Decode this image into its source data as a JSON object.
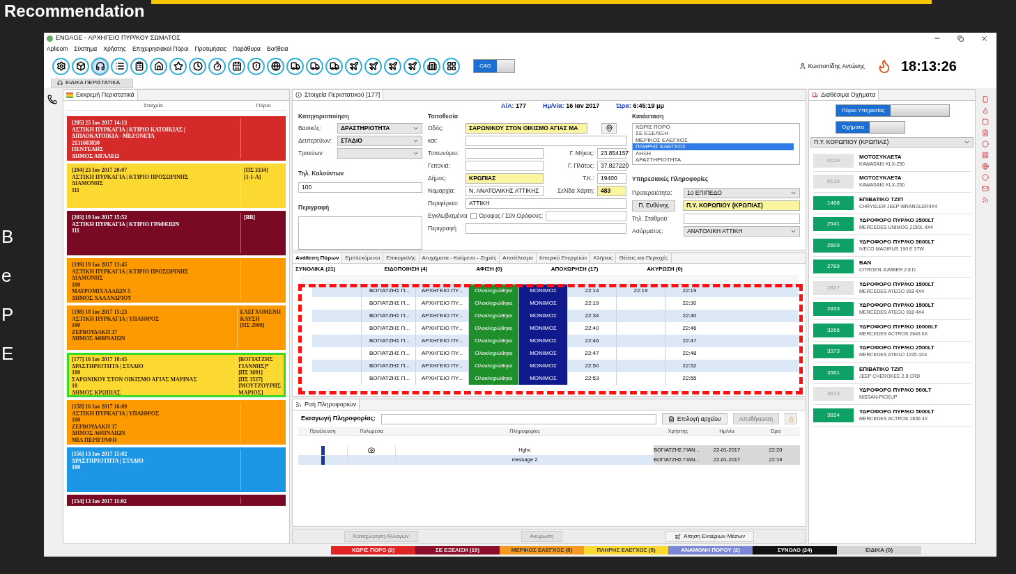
{
  "slide": {
    "title": "Recommendation",
    "side_letters": [
      "B",
      "e",
      "P",
      "E"
    ]
  },
  "window": {
    "title": "ENGAGE - ΑΡΧΗΓΕΙΟ ΠΥΡ/ΚΟΥ ΣΩΜΑΤΟΣ"
  },
  "menu": [
    "Aplicom",
    "Σύστημα",
    "Χρήστης",
    "Επιχειρησιακοί Πόροι",
    "Προτιμήσεις",
    "Παράθυρα",
    "Βοήθεια"
  ],
  "toolbar": {
    "buttons": [
      {
        "kind": "gear",
        "selected": false
      },
      {
        "kind": "box",
        "selected": false
      },
      {
        "kind": "headset",
        "selected": true
      },
      {
        "kind": "list",
        "selected": false
      },
      {
        "kind": "clipboard",
        "selected": false
      },
      {
        "kind": "house",
        "selected": false
      },
      {
        "kind": "star",
        "selected": false
      },
      {
        "kind": "clock",
        "selected": false
      },
      {
        "kind": "timer",
        "selected": false
      },
      {
        "kind": "calendar",
        "selected": false
      },
      {
        "kind": "shield",
        "selected": false
      },
      {
        "kind": "globe",
        "selected": false
      },
      {
        "kind": "truck",
        "selected": false
      },
      {
        "kind": "truck",
        "selected": false
      },
      {
        "kind": "truck",
        "selected": false
      },
      {
        "kind": "plane",
        "selected": false
      },
      {
        "kind": "plane",
        "selected": false
      },
      {
        "kind": "plane",
        "selected": false
      },
      {
        "kind": "plane",
        "selected": false
      },
      {
        "kind": "building",
        "selected": false
      },
      {
        "kind": "grid",
        "selected": false
      }
    ],
    "cad": {
      "label": "CAD",
      "on": true
    },
    "special_button": "ΕΙΔΙΚΑ ΠΕΡΙΣΤΑΤΙΚΑ",
    "user": "Κωστοπίδης Αντώνης",
    "clock": "18:13:26"
  },
  "pending": {
    "title": "Εκκρεμή Περιστατικά",
    "columns": [
      "Στοιχεία",
      "Πόροι"
    ],
    "incidents": [
      {
        "lines": [
          "[205] 25 Ιαν 2017 14:13",
          "ΑΣΤΙΚΗ ΠΥΡΚΑΓΙΑ | ΚΤΙΡΙΟ ΚΑΤΟΙΚΙΑΣ |",
          "ΔΙΠΛΟΚΑΤΟΙΚΙΑ - ΜΕΖΟΝΕΤΑ",
          "2131603830",
          "ΠΕΝΤΕΛΗΣ",
          "ΔΗΜΟΣ ΑΙΓΑΛΕΩ"
        ],
        "color": "#d42a2a",
        "selected": false
      },
      {
        "lines": [
          "[204] 23 Ιαν 2017 20:07",
          "ΑΣΤΙΚΗ ΠΥΡΚΑΓΙΑ | ΚΤΙΡΙΟ ΠΡΟΣΩΡΙΝΗΣ",
          "ΔΙΑΜΟΝΗΣ",
          "111"
        ],
        "resources": [
          "[ΠΣ 3334]",
          "[1-1-Α]"
        ],
        "color": "#fbd930",
        "selected": false
      },
      {
        "lines": [
          "[203] 19 Ιαν 2017 15:52",
          "ΑΣΤΙΚΗ ΠΥΡΚΑΓΙΑ | ΚΤΙΡΙΟ ΓΡΑΦΕΙΩΝ",
          "111"
        ],
        "resources": [
          "[ΒΒ]"
        ],
        "color": "#7a0a24",
        "selected": false
      },
      {
        "lines": [
          "[199] 19 Ιαν 2017 13:45",
          "ΑΣΤΙΚΗ ΠΥΡΚΑΓΙΑ | ΚΤΙΡΙΟ ΠΡΟΣΩΡΙΝΗΣ",
          "ΔΙΑΜΟΝΗΣ",
          "100",
          "ΜΑΥΡΟΜΙΧΑΛΑΙΩΝ 5",
          "ΔΗΜΟΣ ΧΑΛΑΝΔΡΙΟΥ"
        ],
        "color": "#fd9a00",
        "selected": false
      },
      {
        "lines": [
          "[198] 18 Ιαν 2017 15:23",
          "ΑΣΤΙΚΗ ΠΥΡΚΑΓΙΑ | ΥΠΑΙΘΡΟΣ",
          "100",
          "ΖΕΡΒΟΥΔΑΚΗ 37",
          "ΔΗΜΟΣ ΑΘΗΝΑΙΩΝ"
        ],
        "resources": [
          "ΕΛΕΓΧΟΜΕΝΗ",
          "ΚΑΥΣΗ",
          "[ΠΣ 2908]"
        ],
        "color": "#fd9a00",
        "selected": false
      },
      {
        "lines": [
          "[177] 16 Ιαν 2017 18:45",
          "ΔΡΑΣΤΗΡΙΟΤΗΤΑ | ΣΤΑΔΙΟ",
          "100",
          "ΣΑΡΩΝΙΚΟΥ ΣΤΟΝ ΟΙΚΙΣΜΟ ΑΓΙΑΣ ΜΑΡΙΝΑΣ",
          "10",
          "ΔΗΜΟΣ ΚΡΩΠΙΑΣ"
        ],
        "resources": [
          "[ΒΟΓΙΑΤΖΗΣ",
          "ΓΙΑΝΝΗΣ]*",
          "[ΠΣ 3691]",
          "[ΠΣ 3527]",
          "[ΜΟΥΤΖΟΥΡΗΣ",
          "ΜΑΡΙΟΣ]"
        ],
        "color": "#fbd930",
        "selected": true
      },
      {
        "lines": [
          "[158] 16 Ιαν 2017 16:09",
          "ΑΣΤΙΚΗ ΠΥΡΚΑΓΙΑ | ΥΠΑΙΘΡΟΣ",
          "100",
          "ΖΕΡΒΟΥΔΑΚΗ 37",
          "ΔΗΜΟΣ ΑΘΗΝΑΙΩΝ",
          "ΜΙΑ ΠΕΡΙΓΡΑΦΗ"
        ],
        "color": "#fd9a00",
        "selected": false
      },
      {
        "lines": [
          "[156] 13 Ιαν 2017 15:02",
          "ΔΡΑΣΤΗΡΙΟΤΗΤΑ | ΣΤΑΔΙΟ",
          "100"
        ],
        "color": "#1e96e6",
        "selected": false
      },
      {
        "lines": [
          "[154] 13 Ιαν 2017 11:02"
        ],
        "color": "#7a0a24",
        "selected": false
      }
    ]
  },
  "details": {
    "title": "Στοιχεία Περιστατικού [177]",
    "header": [
      {
        "label": "Α/Α:",
        "value": "177"
      },
      {
        "label": "Ημ/νία:",
        "value": "16 Ιαν 2017"
      },
      {
        "label": "Ώρα:",
        "value": "6:45:19 μμ"
      }
    ],
    "classification": {
      "title": "Κατηγοριοποίηση",
      "fields": [
        {
          "label": "Βασικός:",
          "value": "ΔΡΑΣΤΗΡΙΟΤΗΤΑ"
        },
        {
          "label": "Δευτερεύων:",
          "value": "ΣΤΑΔΙΟ"
        },
        {
          "label": "Τριτεύων:"
        }
      ]
    },
    "caller": {
      "label": "Τηλ. Καλούντων",
      "value": "100"
    },
    "description": {
      "label": "Περιγραφή"
    },
    "location": {
      "title": "Τοποθεσία",
      "rows": [
        [
          {
            "label": "Οδός:",
            "value": "ΣΑΡΩΝΙΚΟΥ ΣΤΟΝ ΟΙΚΙΣΜΟ ΑΓΙΑΣ ΜΑ",
            "highlighted": true
          }
        ],
        [
          {
            "label": "και:",
            "highlighted": false
          }
        ],
        [
          {
            "label": "Τοπωνύμιο:",
            "highlighted": false
          },
          {
            "label": "Γ. Μήκος:",
            "value": "23.854157",
            "highlighted": false
          }
        ],
        [
          {
            "label": "Γειτονιά:",
            "highlighted": false
          },
          {
            "label": "Γ. Πλάτος:",
            "value": "37.827220",
            "highlighted": false
          }
        ],
        [
          {
            "label": "Δήμος:",
            "value": "ΚΡΩΠΙΑΣ",
            "highlighted": true
          },
          {
            "label": "Τ.Κ.:",
            "value": "19400",
            "highlighted": false
          }
        ],
        [
          {
            "label": "Νομαρχία:",
            "value": "Ν. ΑΝΑΤΟΛΙΚΗΣ ΑΤΤΙΚΗΣ",
            "highlighted": false
          },
          {
            "label": "Σελίδα Χάρτη:",
            "value": "483",
            "highlighted": true
          }
        ],
        [
          {
            "label": "Περιφέρεια:",
            "value": "ΑΤΤΙΚΗ",
            "highlighted": false
          }
        ]
      ],
      "trapped": {
        "label": "Εγκλωβισμένοι",
        "checked": false
      },
      "floor_label": "Όροφος / Σύν.Ορόφους:",
      "description_label": "Περιγραφή"
    },
    "status": {
      "title": "Κατάσταση",
      "items": [
        {
          "label": "ΧΩΡΙΣ ΠΟΡΟ",
          "selected": false
        },
        {
          "label": "ΣΕ ΕΞΕΛΙΞΗ",
          "selected": false
        },
        {
          "label": "ΜΕΡΙΚΟΣ ΕΛΕΓΧΟΣ",
          "selected": false
        },
        {
          "label": "ΠΛΗΡΗΣ ΕΛΕΓΧΟΣ",
          "selected": true
        },
        {
          "label": "ΛΗΞΗ",
          "selected": false
        },
        {
          "label": "ΔΡΑΣΤΗΡΙΟΤΗΤΑ",
          "selected": false
        }
      ]
    },
    "service": {
      "title": "Υπηρεσιακές Πληροφορίες",
      "priority": {
        "label": "Προτεραιότητα:",
        "value": "1ο ΕΠΙΠΕΔΟ"
      },
      "responsible": {
        "label": "Π. Ευθύνης",
        "value": "Π.Υ. ΚΟΡΩΠΙΟΥ (ΚΡΩΠΙΑΣ)"
      },
      "station_phone": {
        "label": "Τηλ. Σταθμού:"
      },
      "radio": {
        "label": "Ασύρματος:",
        "value": "ΑΝΑΤΟΛΙΚΗ ΑΤΤΙΚΗ"
      }
    }
  },
  "tabs": [
    {
      "label": "Ανάθεση Πόρων",
      "selected": true
    },
    {
      "label": "Εμπλεκόμενοι",
      "selected": false
    },
    {
      "label": "Επικεφαλής",
      "selected": false
    },
    {
      "label": "Ατυχήματα - Καύμενα - Ζημιές",
      "selected": false
    },
    {
      "label": "Αποτέλεσμα",
      "selected": false
    },
    {
      "label": "Ιστορικό Ενεργειών",
      "selected": false
    },
    {
      "label": "Κλήσεις",
      "selected": false
    },
    {
      "label": "Θέσεις και Περιοχές",
      "selected": false
    }
  ],
  "summary": [
    "ΣΥΝΟΛΙΚΑ (21)",
    "ΕΙΔΟΠΟΙΗΣΗ (4)",
    "ΑΦΙΞΗ (0)",
    "ΑΠΟΧΩΡΗΣΗ (17)",
    "ΑΚΥΡΩΣΗ (0)"
  ],
  "resources_table": {
    "rows": [
      [
        "ΒΟΓΙΑΤΖΗΣ Π...",
        "ΑΡΧΗΓΕΙΟ ΠΥ...",
        "Ολοκληρώθηκε",
        "ΜΟΝΙΜΟΣ",
        "22:14",
        "22:19",
        "22:19"
      ],
      [
        "ΒΟΓΙΑΤΖΗΣ Π...",
        "ΑΡΧΗΓΕΙΟ ΠΥ...",
        "Ολοκληρώθηκε",
        "ΜΟΝΙΜΟΣ",
        "22:19",
        null,
        "22:30"
      ],
      [
        "ΒΟΓΙΑΤΖΗΣ Π...",
        "ΑΡΧΗΓΕΙΟ ΠΥ...",
        "Ολοκληρώθηκε",
        "ΜΟΝΙΜΟΣ",
        "22:34",
        null,
        "22:40"
      ],
      [
        "ΒΟΓΙΑΤΖΗΣ Π...",
        "ΑΡΧΗΓΕΙΟ ΠΥ...",
        "Ολοκληρώθηκε",
        "ΜΟΝΙΜΟΣ",
        "22:40",
        null,
        "22:46"
      ],
      [
        "ΒΟΓΙΑΤΖΗΣ Π...",
        "ΑΡΧΗΓΕΙΟ ΠΥ...",
        "Ολοκληρώθηκε",
        "ΜΟΝΙΜΟΣ",
        "22:46",
        null,
        "22:47"
      ],
      [
        "ΒΟΓΙΑΤΖΗΣ Π...",
        "ΑΡΧΗΓΕΙΟ ΠΥ...",
        "Ολοκληρώθηκε",
        "ΜΟΝΙΜΟΣ",
        "22:47",
        null,
        "22:48"
      ],
      [
        "ΒΟΓΙΑΤΖΗΣ Π...",
        "ΑΡΧΗΓΕΙΟ ΠΥ...",
        "Ολοκληρώθηκε",
        "ΜΟΝΙΜΟΣ",
        "22:50",
        null,
        "22:52"
      ],
      [
        "ΒΟΓΙΑΤΖΗΣ Π...",
        "ΑΡΧΗΓΕΙΟ ΠΥ...",
        "Ολοκληρώθηκε",
        "ΜΟΝΙΜΟΣ",
        "22:53",
        null,
        "22:55"
      ]
    ]
  },
  "info_flow": {
    "title": "Ροή Πληροφοριών",
    "input_label": "Εισαγωγή Πληροφορίας:",
    "file_button": "Επιλογή αρχείου",
    "save_button": {
      "label": "Αποθήκευση",
      "disabled": true
    },
    "columns": [
      "Προέλευση",
      "Πολυμέσα",
      "Πληροφορίες",
      "Χρήστης",
      "Ημ/νία",
      "Ώρα"
    ],
    "rows": [
      {
        "media": true,
        "info": "Hghc",
        "user": "ΒΟΓΙΑΤΖΗΣ ΓΙΑΝ...",
        "date": "22-01-2017",
        "time": "22:20"
      },
      {
        "media": false,
        "info": "message 2",
        "user": "ΒΟΓΙΑΤΖΗΣ ΓΙΑΝ...",
        "date": "22-01-2017",
        "time": "22:19"
      }
    ]
  },
  "bottom_buttons": [
    {
      "label": "Καταχώρηση Αλλαγών",
      "disabled": true
    },
    {
      "label": "Ακύρωση",
      "disabled": true
    },
    {
      "label": "Αίτηση Εναέριων Μέσων",
      "disabled": false
    }
  ],
  "vehicles": {
    "title": "Διαθέσιμα Οχήματα",
    "toggles": [
      {
        "label": "Πόροι Υπηρεσίας",
        "on": true
      },
      {
        "label": "Οχήματα",
        "on": true
      }
    ],
    "station": "Π.Υ. ΚΟΡΩΠΙΟΥ (ΚΡΩΠΙΑΣ)",
    "items": [
      {
        "code": "0129",
        "type": "ΜΟΤΟΣΥΚΛΕΤΑ",
        "model": "KAWASAKI KLX-250",
        "available": false
      },
      {
        "code": "0130",
        "type": "ΜΟΤΟΣΥΚΛΕΤΑ",
        "model": "KAWASAKI KLX-250",
        "available": false
      },
      {
        "code": "1488",
        "type": "ΕΠΙΒΑΤΙΚΟ ΤΖΙΠ",
        "model": "CHRYSLER JEEP WRANGLER4X4",
        "available": true
      },
      {
        "code": "2541",
        "type": "ΥΔΡΟΦΟΡΟ ΠΥΡ/ΚΟ 2500LT",
        "model": "MERCEDES UNIMOG 2150L 4X4",
        "available": true
      },
      {
        "code": "2609",
        "type": "ΥΔΡΟΦΟΡΟ ΠΥΡ/ΚΟ 5000LT",
        "model": "IVECO MAGIRUS 190 E 37W",
        "available": true
      },
      {
        "code": "2789",
        "type": "ΒΑΝ",
        "model": "CITROEN JUMBER 2.8 D",
        "available": true
      },
      {
        "code": "2827",
        "type": "ΥΔΡΟΦΟΡΟ ΠΥΡ/ΚΟ 1500LT",
        "model": "MERCEDES ATEGO 918 4X4",
        "available": false
      },
      {
        "code": "2833",
        "type": "ΥΔΡΟΦΟΡΟ ΠΥΡ/ΚΟ 1500LT",
        "model": "MERCEDES ATEGO 918 4X4",
        "available": true
      },
      {
        "code": "3266",
        "type": "ΥΔΡΟΦΟΡΟ ΠΥΡ/ΚΟ 10000LT",
        "model": "MERCEDES ACTROS 2643 6X",
        "available": true
      },
      {
        "code": "3373",
        "type": "ΥΔΡΟΦΟΡΟ ΠΥΡ/ΚΟ 2500LT",
        "model": "MERCEDES ATEGO 1225 4X4",
        "available": true
      },
      {
        "code": "3561",
        "type": "ΕΠΙΒΑΤΙΚΟ ΤΖΙΠ",
        "model": "JEEP CHEROKEE 2.8 CRD",
        "available": true
      },
      {
        "code": "3613",
        "type": "ΥΔΡΟΦΟΡΟ ΠΥΡ/ΚΟ 500LT",
        "model": "NISSAN-PICKUP",
        "available": false
      },
      {
        "code": "3824",
        "type": "ΥΔΡΟΦΟΡΟ ΠΥΡ/ΚΟ 5000LT",
        "model": "MERCEDES ACTROS 1836 4X",
        "available": true
      }
    ]
  },
  "status_bar": [
    {
      "label": "ΧΩΡΙΣ ΠΟΡΟ (2)",
      "color": "#e02424"
    },
    {
      "label": "ΣΕ ΕΞΕΛΙΞΗ (10)",
      "color": "#8b0d2a"
    },
    {
      "label": "ΜΕΡΙΚΟΣ ΕΛΕΓΧΟΣ (5)",
      "color": "#f59a1e"
    },
    {
      "label": "ΠΛΗΡΗΣ ΕΛΕΓΧΟΣ (5)",
      "color": "#fbd930"
    },
    {
      "label": "ΑΝΑΜΟΝΗ ΠΟΡΟΥ (2)",
      "color": "#7c86d6"
    },
    {
      "label": "ΣΥΝΟΛΟ (24)",
      "color": "#111111"
    },
    {
      "label": "ΕΙΔΙΚΑ (0)",
      "color": "#d4d4d4"
    }
  ]
}
